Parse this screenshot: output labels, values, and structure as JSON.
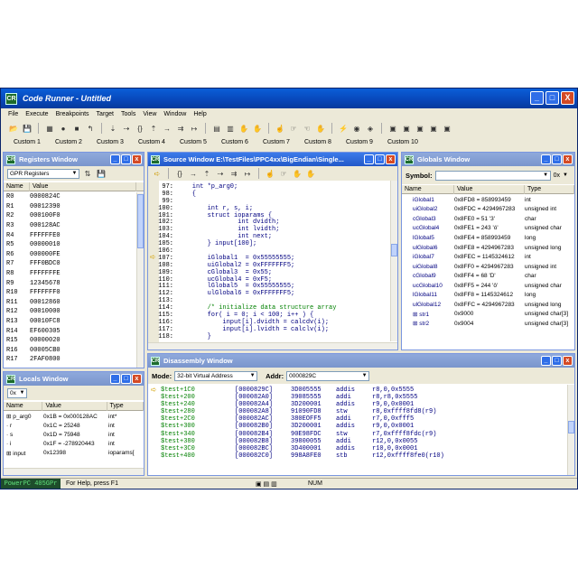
{
  "window": {
    "title": "Code Runner - Untitled",
    "minimize": "_",
    "maximize": "□",
    "close": "X"
  },
  "menu": [
    "File",
    "Execute",
    "Breakpoints",
    "Target",
    "Tools",
    "View",
    "Window",
    "Help"
  ],
  "custom_buttons": [
    "Custom 1",
    "Custom 2",
    "Custom 3",
    "Custom 4",
    "Custom 5",
    "Custom 6",
    "Custom 7",
    "Custom 8",
    "Custom 9",
    "Custom 10"
  ],
  "registers": {
    "title": "Registers Window",
    "set": "GPR Registers",
    "columns": [
      "Name",
      "Value"
    ],
    "rows": [
      [
        "R0",
        "0000824C"
      ],
      [
        "R1",
        "00012390"
      ],
      [
        "R2",
        "000100F0"
      ],
      [
        "R3",
        "000128AC"
      ],
      [
        "R4",
        "FFFFFFE0"
      ],
      [
        "R5",
        "00000010"
      ],
      [
        "R6",
        "000000FE"
      ],
      [
        "R7",
        "FFF0BDC0"
      ],
      [
        "R8",
        "FFFFFFFE"
      ],
      [
        "R9",
        "12345678"
      ],
      [
        "R10",
        "FFFFFFF0"
      ],
      [
        "R11",
        "00012860"
      ],
      [
        "R12",
        "00010000"
      ],
      [
        "R13",
        "00010FC8"
      ],
      [
        "R14",
        "EF600305"
      ],
      [
        "R15",
        "00000020"
      ],
      [
        "R16",
        "00005CB0"
      ],
      [
        "R17",
        "2FAF0800"
      ]
    ]
  },
  "locals": {
    "title": "Locals Window",
    "radix": "0x",
    "columns": [
      "Name",
      "Value",
      "Type"
    ],
    "rows": [
      [
        "p_arg0",
        "0x1B = 0x000128AC",
        "int*"
      ],
      [
        "r",
        "0x1C = 25248",
        "int"
      ],
      [
        "s",
        "0x1D = 75948",
        "int"
      ],
      [
        "i",
        "0x1F = -278920443",
        "int"
      ],
      [
        "input",
        "0x12398",
        "ioparams["
      ]
    ]
  },
  "source": {
    "title": "Source Window E:\\TestFiles\\PPC4xx\\BigEndian\\Single...",
    "lines": [
      {
        "n": "97:",
        "t": "    int *p_arg0;"
      },
      {
        "n": "98:",
        "t": "    {"
      },
      {
        "n": "99:",
        "t": ""
      },
      {
        "n": "100:",
        "t": "        int r, s, i;"
      },
      {
        "n": "101:",
        "t": "        struct ioparams {"
      },
      {
        "n": "102:",
        "t": "                int dvidth;"
      },
      {
        "n": "103:",
        "t": "                int lvidth;"
      },
      {
        "n": "104:",
        "t": "                int next;"
      },
      {
        "n": "105:",
        "t": "        } input[100];"
      },
      {
        "n": "106:",
        "t": ""
      },
      {
        "n": "107:",
        "t": "        iGlobal1  = 0x55555555;"
      },
      {
        "n": "108:",
        "t": "        uiGlobal2 = 0xFFFFFFF5;"
      },
      {
        "n": "109:",
        "t": "        cGlobal3  = 0x55;"
      },
      {
        "n": "110:",
        "t": "        ucGlobal4 = 0xF5;"
      },
      {
        "n": "111:",
        "t": "        lGlobal5  = 0x55555555;"
      },
      {
        "n": "112:",
        "t": "        ulGlobal6 = 0xFFFFFFF5;"
      },
      {
        "n": "113:",
        "t": ""
      },
      {
        "n": "114:",
        "t": "        /* initialize data structure array"
      },
      {
        "n": "115:",
        "t": "        for( i = 0; i < 100; i++ ) {"
      },
      {
        "n": "116:",
        "t": "            input[i].dvidth = calcdv(i);"
      },
      {
        "n": "117:",
        "t": "            input[i].lvidth = calclv(i);"
      },
      {
        "n": "118:",
        "t": "        }"
      }
    ]
  },
  "globals": {
    "title": "Globals Window",
    "symbol_label": "Symbol:",
    "radix": "0x",
    "columns": [
      "Name",
      "Value",
      "Type"
    ],
    "rows": [
      [
        "iGlobal1",
        "0x8FD8 = 858993459",
        "int"
      ],
      [
        "uiGlobal2",
        "0x8FDC = 4294967283",
        "unsigned int"
      ],
      [
        "cGlobal3",
        "0x8FE0 = 51 '3'",
        "char"
      ],
      [
        "ucGlobal4",
        "0x8FE1 = 243 'ó'",
        "unsigned char"
      ],
      [
        "lGlobal5",
        "0x8FE4 = 858993459",
        "long"
      ],
      [
        "ulGlobal6",
        "0x8FE8 = 4294967283",
        "unsigned long"
      ],
      [
        "iGlobal7",
        "0x8FEC = 1145324612",
        "int"
      ],
      [
        "uiGlobal8",
        "0x8FF0 = 4294967283",
        "unsigned int"
      ],
      [
        "cGlobal9",
        "0x8FF4 = 68 'D'",
        "char"
      ],
      [
        "ucGlobal10",
        "0x8FF5 = 244 'ô'",
        "unsigned char"
      ],
      [
        "lGlobal11",
        "0x8FF8 = 1145324612",
        "long"
      ],
      [
        "ulGlobal12",
        "0x8FFC = 4294967283",
        "unsigned long"
      ],
      [
        "str1",
        "0x9000",
        "unsigned char[3]"
      ],
      [
        "str2",
        "0x9004",
        "unsigned char[3]"
      ]
    ]
  },
  "disassembly": {
    "title": "Disassembly Window",
    "mode_label": "Mode:",
    "mode_value": "32-bit Virtual Address",
    "addr_label": "Addr:",
    "addr_value": "0000829C",
    "lines": [
      [
        "$test+1C0",
        "[0000829C]",
        "3D005555",
        "addis",
        "r8,0,0x5555"
      ],
      [
        "$test+200",
        "[000082A0]",
        "39085555",
        "addi",
        "r8,r8,0x5555"
      ],
      [
        "$test+240",
        "[000082A4]",
        "3D200001",
        "addis",
        "r9,0,0x0001"
      ],
      [
        "$test+280",
        "[000082A8]",
        "91090FD8",
        "stw",
        "r8,0xffff8fd8(r9)"
      ],
      [
        "$test+2C0",
        "[000082AC]",
        "380EOFF5",
        "addi",
        "r7,0,0xfff5"
      ],
      [
        "$test+300",
        "[000082B0]",
        "3D200001",
        "addis",
        "r9,0,0x0001"
      ],
      [
        "$test+340",
        "[000082B4]",
        "90E98FDC",
        "stw",
        "r7,0xffff8fdc(r9)"
      ],
      [
        "$test+380",
        "[000082B8]",
        "39800055",
        "addi",
        "r12,0,0x0055"
      ],
      [
        "$test+3C0",
        "[000082BC]",
        "3D400001",
        "addis",
        "r10,0,0x0001"
      ],
      [
        "$test+400",
        "[000082C0]",
        "998A8FE0",
        "stb",
        "r12,0xffff8fe0(r10)"
      ]
    ]
  },
  "status": {
    "target": "PowerPC 405GPr",
    "help": "For Help, press F1",
    "num": "NUM"
  }
}
